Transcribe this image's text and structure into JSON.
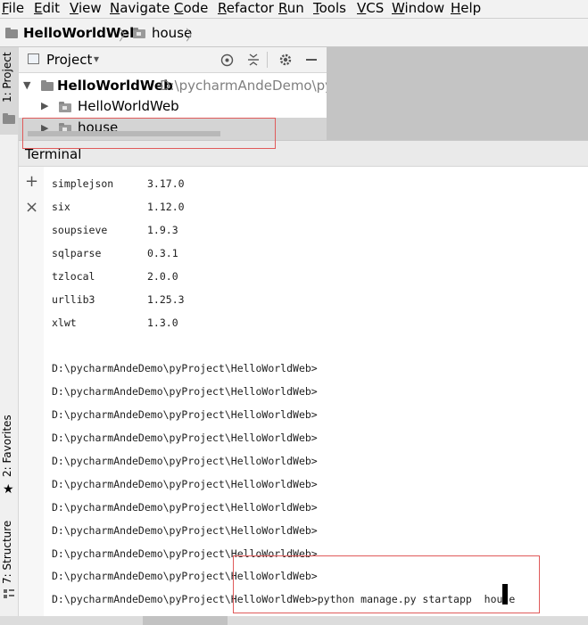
{
  "menu": [
    "File",
    "Edit",
    "View",
    "Navigate",
    "Code",
    "Refactor",
    "Run",
    "Tools",
    "VCS",
    "Window",
    "Help"
  ],
  "breadcrumb": {
    "project": "HelloWorldWeb",
    "folder": "house",
    "sep": "〉"
  },
  "sidebar": {
    "project_tab": "1: Project",
    "favorites_tab": "2: Favorites",
    "structure_tab": "7: Structure"
  },
  "project_panel": {
    "title": "Project",
    "dropdown_arrow": "▾",
    "root_name": "HelloWorldWeb",
    "root_path": "D:\\pycharmAndeDemo\\pyPro",
    "children": [
      "HelloWorldWeb",
      "house"
    ]
  },
  "terminal": {
    "title": "Terminal",
    "add_icon": "+",
    "close_icon": "×",
    "packages": [
      {
        "name": "simplejson",
        "version": "3.17.0"
      },
      {
        "name": "six",
        "version": "1.12.0"
      },
      {
        "name": "soupsieve",
        "version": "1.9.3"
      },
      {
        "name": "sqlparse",
        "version": "0.3.1"
      },
      {
        "name": "tzlocal",
        "version": "2.0.0"
      },
      {
        "name": "urllib3",
        "version": "1.25.3"
      },
      {
        "name": "xlwt",
        "version": "1.3.0"
      }
    ],
    "prompt": "D:\\pycharmAndeDemo\\pyProject\\HelloWorldWeb>",
    "prompt_repeat": 10,
    "command": "python manage.py startapp  house"
  },
  "colors": {
    "highlight_box": "#e05a5a",
    "gray_area": "#c4c4c4"
  }
}
